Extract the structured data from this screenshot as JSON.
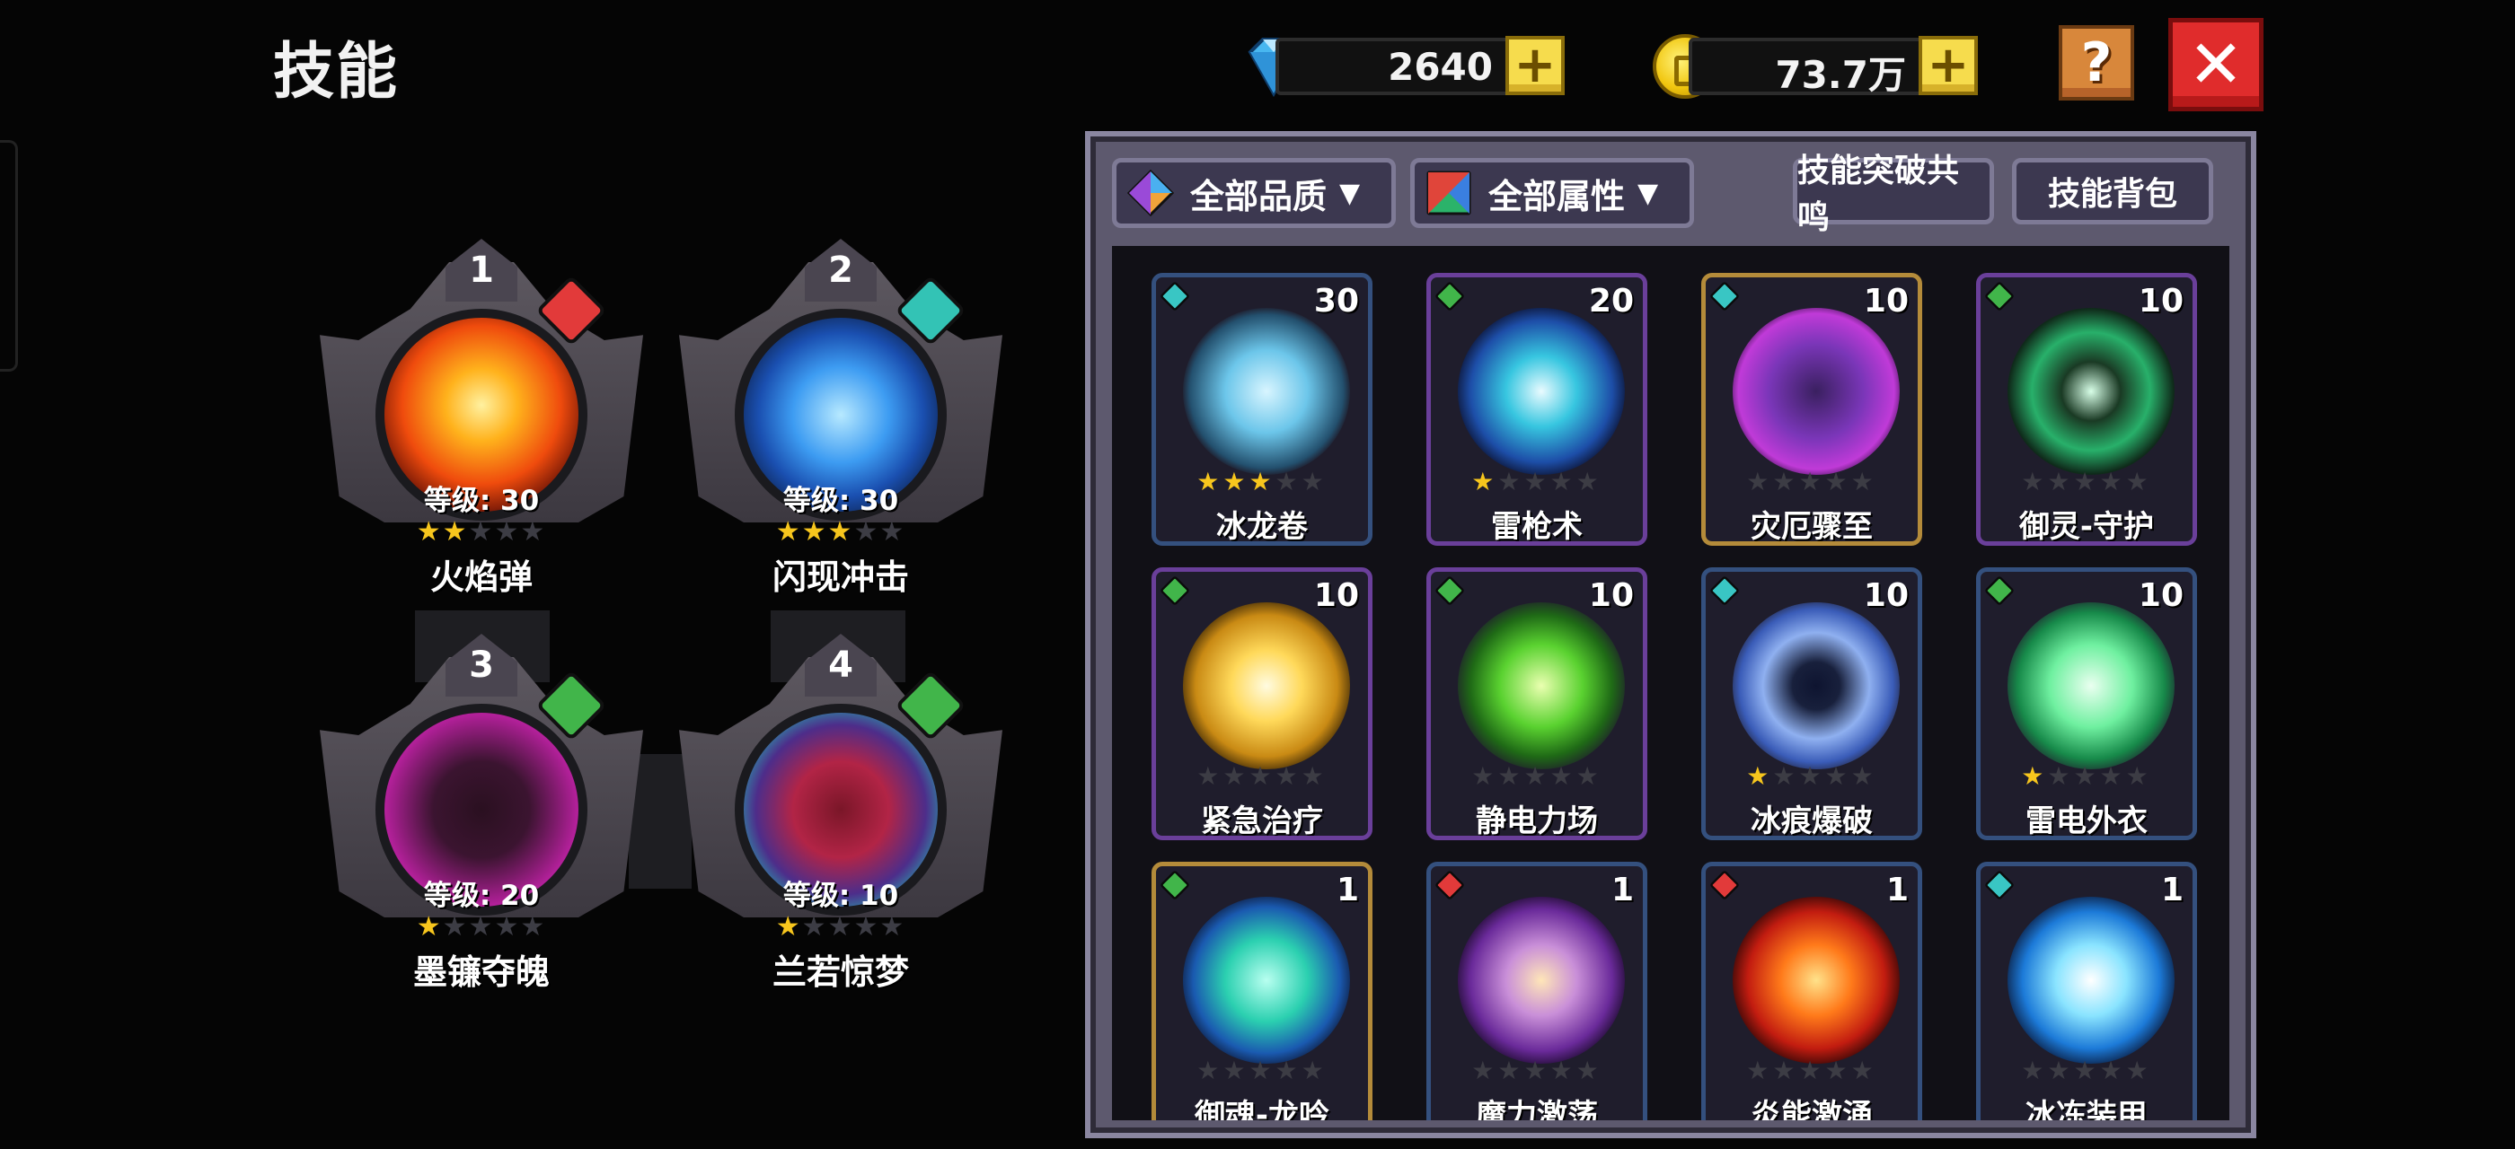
{
  "page_title": "技能",
  "currency": {
    "gems": "2640",
    "coins": "73.7万"
  },
  "header_buttons": {
    "help": "?",
    "close": "✕",
    "plus": "+"
  },
  "equipped": [
    {
      "slot": "1",
      "level": "等级: 30",
      "stars": 2,
      "name": "火焰弹",
      "element_color": "#e23a3a",
      "orb": "fire"
    },
    {
      "slot": "2",
      "level": "等级: 30",
      "stars": 3,
      "name": "闪现冲击",
      "element_color": "#33c3b5",
      "orb": "ice"
    },
    {
      "slot": "3",
      "level": "等级: 20",
      "stars": 1,
      "name": "墨镰夺魄",
      "element_color": "#41b54a",
      "orb": "dark"
    },
    {
      "slot": "4",
      "level": "等级: 10",
      "stars": 1,
      "name": "兰若惊梦",
      "element_color": "#41b54a",
      "orb": "demon"
    }
  ],
  "filters": {
    "quality": "全部品质",
    "attribute": "全部属性",
    "resonance": "技能突破共鸣",
    "bag": "技能背包"
  },
  "skills": [
    {
      "name": "冰龙卷",
      "count": "30",
      "stars": 3,
      "frame": "blue",
      "gem": "#39c6c4",
      "art": "tornado"
    },
    {
      "name": "雷枪术",
      "count": "20",
      "stars": 1,
      "frame": "purple",
      "gem": "#41b54a",
      "art": "lightning"
    },
    {
      "name": "灾厄骤至",
      "count": "10",
      "stars": 0,
      "frame": "gold",
      "gem": "#39c6c4",
      "art": "doom"
    },
    {
      "name": "御灵-守护",
      "count": "10",
      "stars": 0,
      "frame": "purple",
      "gem": "#41b54a",
      "art": "guard"
    },
    {
      "name": "紧急治疗",
      "count": "10",
      "stars": 0,
      "frame": "purple",
      "gem": "#41b54a",
      "art": "heal"
    },
    {
      "name": "静电力场",
      "count": "10",
      "stars": 0,
      "frame": "purple",
      "gem": "#41b54a",
      "art": "static"
    },
    {
      "name": "冰痕爆破",
      "count": "10",
      "stars": 1,
      "frame": "blue",
      "gem": "#39c6c4",
      "art": "iceblast"
    },
    {
      "name": "雷电外衣",
      "count": "10",
      "stars": 1,
      "frame": "blue",
      "gem": "#41b54a",
      "art": "thundercoat"
    },
    {
      "name": "御魂-龙吟",
      "count": "1",
      "stars": 0,
      "frame": "gold",
      "gem": "#41b54a",
      "art": "dragon"
    },
    {
      "name": "魔力激荡",
      "count": "1",
      "stars": 0,
      "frame": "blue",
      "gem": "#e23a3a",
      "art": "arcane"
    },
    {
      "name": "炎能激涌",
      "count": "1",
      "stars": 0,
      "frame": "blue",
      "gem": "#e23a3a",
      "art": "flame"
    },
    {
      "name": "冰冻装甲",
      "count": "1",
      "stars": 0,
      "frame": "blue",
      "gem": "#39c6c4",
      "art": "icearmor"
    }
  ],
  "colors": {
    "background": "#050505",
    "panel": "#5d596e",
    "star_on": "#f7c61d",
    "star_off": "#3c3c44",
    "close_red": "#e02c2c",
    "help_orange": "#d8873b"
  }
}
